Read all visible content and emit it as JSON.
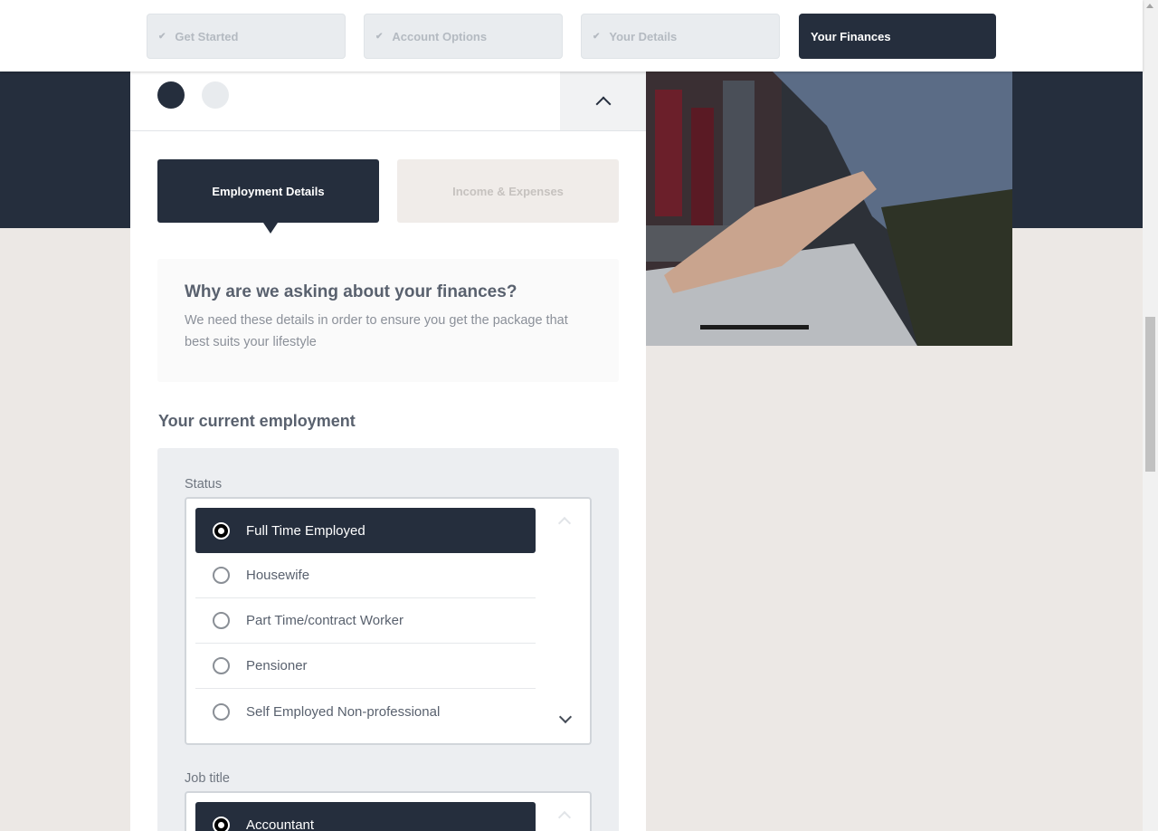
{
  "steps": [
    {
      "label": "Get Started",
      "check": "✔"
    },
    {
      "label": "Account Options",
      "check": "✔"
    },
    {
      "label": "Your Details",
      "check": "✔"
    },
    {
      "label": "Your Finances"
    }
  ],
  "icons": {
    "collapse": "chevron-up-icon",
    "step_done": "check-icon",
    "select_up": "chevron-up-icon",
    "select_down": "chevron-down-icon"
  },
  "colors": {
    "primary": "#252e3d",
    "background": "#ece8e5",
    "panel": "#ffffff"
  },
  "tabs": {
    "active": "Employment Details",
    "inactive": "Income & Expenses"
  },
  "info": {
    "title": "Why are we asking about your finances?",
    "text": "We need these details in order to ensure you get the package that best suits your lifestyle"
  },
  "section_title": "Your current employment",
  "status": {
    "label": "Status",
    "options": [
      "Full Time Employed",
      "Housewife",
      "Part Time/contract Worker",
      "Pensioner",
      "Self Employed Non-professional"
    ],
    "selected": "Full Time Employed"
  },
  "job": {
    "label": "Job title",
    "options": [
      "Accountant"
    ],
    "selected": "Accountant"
  }
}
